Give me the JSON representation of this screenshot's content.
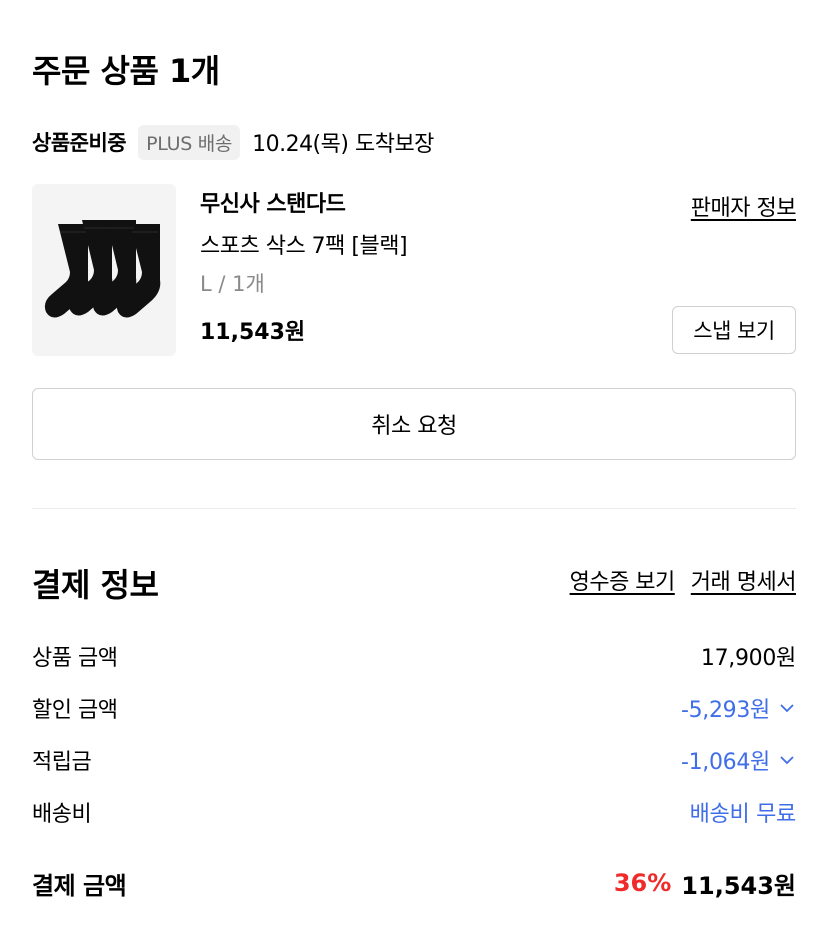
{
  "order": {
    "title": "주문 상품 1개",
    "status": "상품준비중",
    "delivery_badge": "PLUS 배송",
    "arrival_text": "10.24(목) 도착보장",
    "product": {
      "brand": "무신사 스탠다드",
      "name": "스포츠 삭스 7팩 [블랙]",
      "option": "L / 1개",
      "price": "11,543원",
      "seller_link": "판매자 정보",
      "snap_button": "스냅 보기",
      "image_icon": "black-socks-image"
    },
    "cancel_button": "취소 요청"
  },
  "payment": {
    "title": "결제 정보",
    "receipt_link": "영수증 보기",
    "statement_link": "거래 명세서",
    "rows": {
      "product_amount": {
        "label": "상품 금액",
        "value": "17,900원"
      },
      "discount_amount": {
        "label": "할인 금액",
        "value": "-5,293원"
      },
      "points": {
        "label": "적립금",
        "value": "-1,064원"
      },
      "shipping": {
        "label": "배송비",
        "value": "배송비 무료"
      }
    },
    "total": {
      "label": "결제 금액",
      "rate": "36%",
      "value": "11,543원"
    }
  },
  "colors": {
    "accent_blue": "#3f6ee8",
    "discount_red": "#f02a2a",
    "badge_bg": "#f1f1f1",
    "border": "#d0d0d0"
  }
}
